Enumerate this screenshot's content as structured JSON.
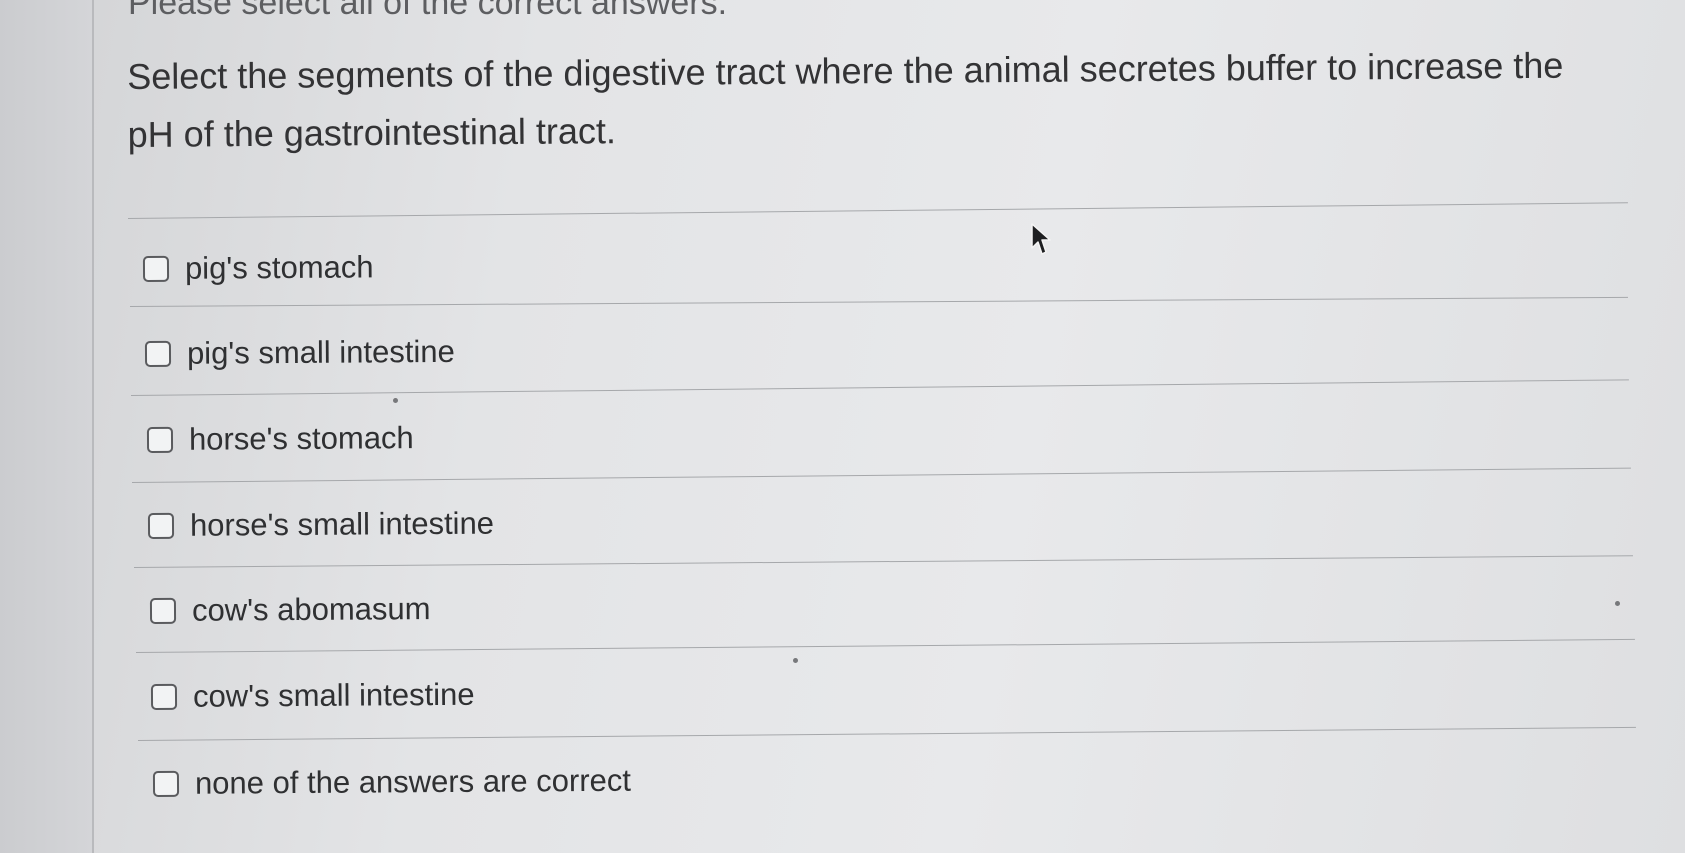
{
  "instruction": "Please select all of the correct answers.",
  "question": "Select the segments of the digestive tract where the animal secretes buffer to increase the pH of the gastrointestinal tract.",
  "options": [
    {
      "label": "pig's stomach",
      "checked": false
    },
    {
      "label": "pig's small intestine",
      "checked": false
    },
    {
      "label": "horse's stomach",
      "checked": false
    },
    {
      "label": "horse's small intestine",
      "checked": false
    },
    {
      "label": "cow's abomasum",
      "checked": false
    },
    {
      "label": "cow's small intestine",
      "checked": false
    },
    {
      "label": "none of the answers are correct",
      "checked": false
    }
  ],
  "icons": {
    "cursor": "mouse-pointer-arrow"
  },
  "colors": {
    "text": "#2f3032",
    "divider": "#a6a8ab",
    "checkbox_border": "#5a5b5e"
  }
}
